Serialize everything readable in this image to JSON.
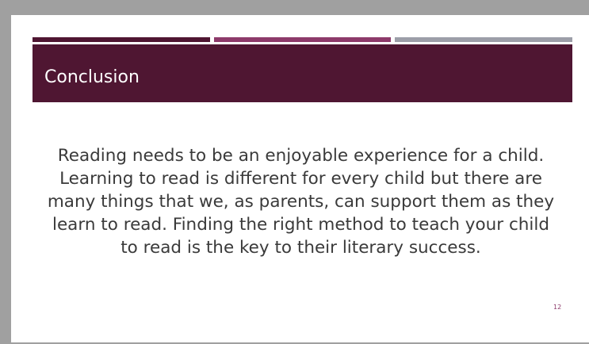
{
  "slide": {
    "title": "Conclusion",
    "body": "Reading needs to be an enjoyable experience for a child. Learning to read is different for every child but there are many things that we, as parents, can support them as they learn to read.  Finding the right method to teach your child to read is the key to their literary success.",
    "page_number": "12"
  },
  "colors": {
    "title_band": "#4f1632",
    "accent_1": "#4f1632",
    "accent_2": "#8d3a6a",
    "accent_3": "#9c9ea8",
    "background": "#ffffff",
    "frame": "#a0a0a0"
  }
}
